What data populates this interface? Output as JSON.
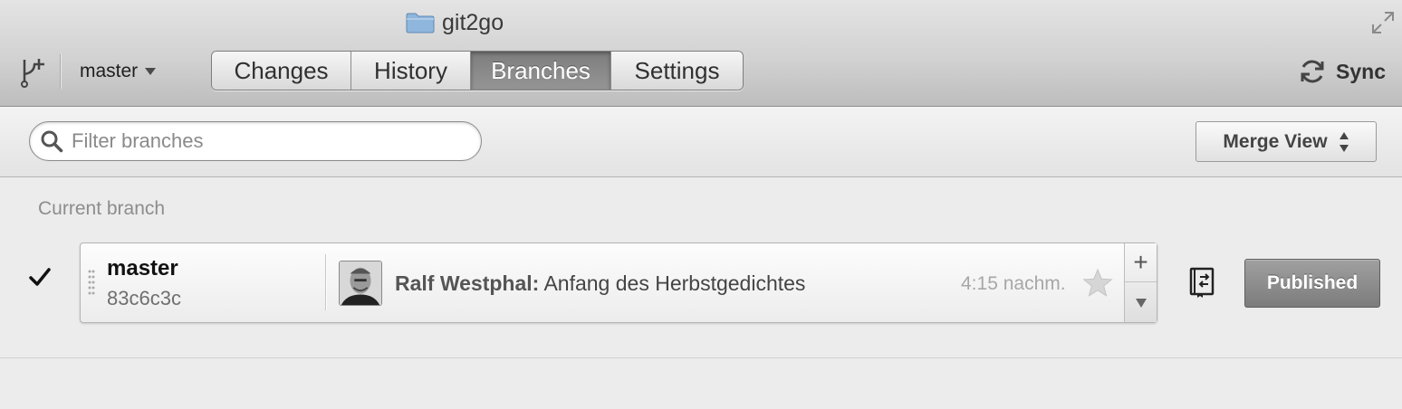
{
  "window": {
    "title": "git2go"
  },
  "toolbar": {
    "current_branch": "master",
    "tabs": [
      {
        "label": "Changes",
        "active": false
      },
      {
        "label": "History",
        "active": false
      },
      {
        "label": "Branches",
        "active": true
      },
      {
        "label": "Settings",
        "active": false
      }
    ],
    "sync_label": "Sync"
  },
  "filter": {
    "placeholder": "Filter branches",
    "value": ""
  },
  "merge_view": {
    "label": "Merge View"
  },
  "current_branch_section": {
    "heading": "Current branch",
    "branch": {
      "name": "master",
      "sha": "83c6c3c",
      "commit_author": "Ralf Westphal:",
      "commit_message": "Anfang des Herbstgedichtes",
      "commit_time": "4:15 nachm.",
      "side_plus": "+",
      "status_label": "Published"
    }
  },
  "icons": {
    "folder": "folder-icon",
    "fullscreen": "fullscreen-icon",
    "branch_tool": "branch-tool-icon",
    "sync": "sync-icon",
    "search": "search-icon",
    "check": "checkmark-icon",
    "star": "star-icon",
    "compare": "compare-icon"
  },
  "colors": {
    "active_tab": "#868686",
    "published_button": "#8c8c8c",
    "folder": "#8fb6dc"
  }
}
